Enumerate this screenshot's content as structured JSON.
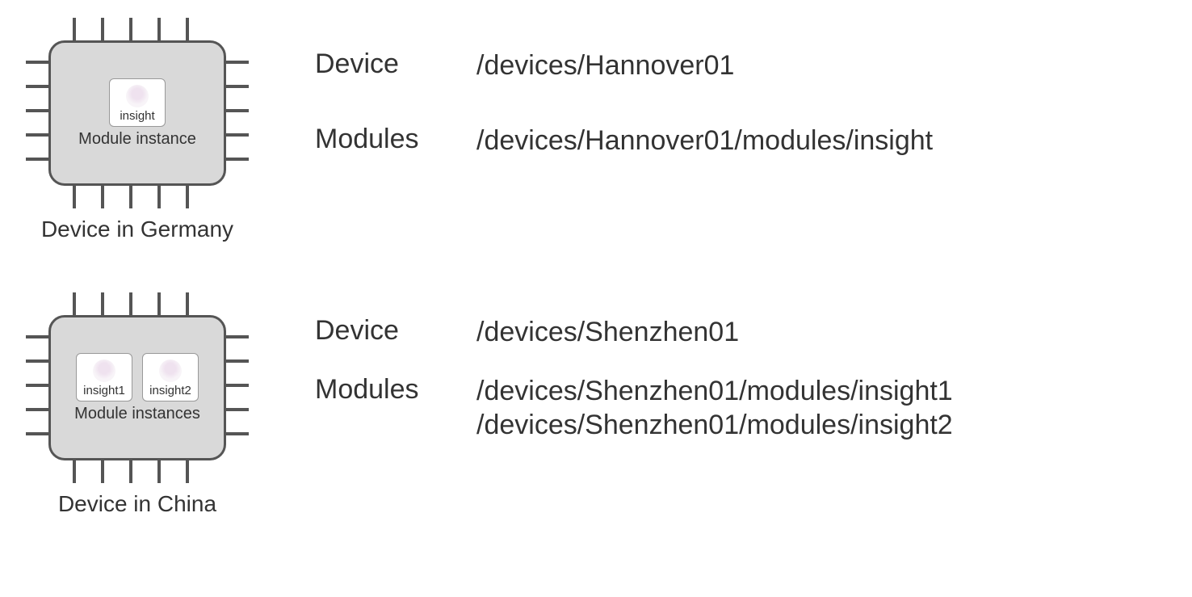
{
  "device1": {
    "caption": "Device in Germany",
    "instances_label": "Module instance",
    "modules": [
      "insight"
    ],
    "info": {
      "device_label": "Device",
      "device_path": "/devices/Hannover01",
      "modules_label": "Modules",
      "module_paths": [
        "/devices/Hannover01/modules/insight"
      ]
    }
  },
  "device2": {
    "caption": "Device in China",
    "instances_label": "Module instances",
    "modules": [
      "insight1",
      "insight2"
    ],
    "info": {
      "device_label": "Device",
      "device_path": "/devices/Shenzhen01",
      "modules_label": "Modules",
      "module_paths": [
        "/devices/Shenzhen01/modules/insight1",
        "/devices/Shenzhen01/modules/insight2"
      ]
    }
  }
}
